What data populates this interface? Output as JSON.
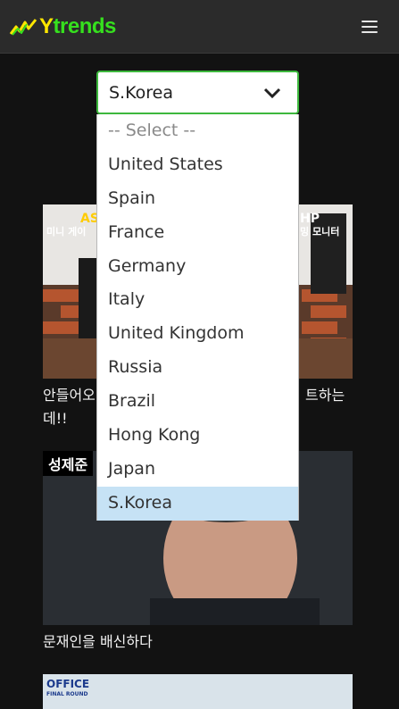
{
  "header": {
    "logo_y": "Y",
    "logo_rest": "trends",
    "menu_icon": "hamburger-icon",
    "colors": {
      "background": "#2b2b2b",
      "logo_y": "#ffe600",
      "logo_rest": "#36e01e"
    }
  },
  "country_select": {
    "selected": "S.Korea",
    "chevron_icon": "chevron-down-icon",
    "border_color": "#3db83d",
    "options": [
      "-- Select --",
      "United States",
      "Spain",
      "France",
      "Germany",
      "Italy",
      "United Kingdom",
      "Russia",
      "Brazil",
      "Hong Kong",
      "Japan",
      "S.Korea"
    ],
    "highlight_color": "#c6e2f5"
  },
  "videos": [
    {
      "title": "안들어오 트하는 데!!",
      "title_line1_left": "안들어오",
      "title_line1_right": "트하는",
      "title_line2": "데!!",
      "thumb_labels": {
        "left_top": "ASU",
        "left_bottom": "미니 게이",
        "right_top": "HP",
        "right_bottom": "밍 모니터"
      }
    },
    {
      "title": "문재인을 배신하다",
      "thumb_label": "성제준"
    },
    {
      "thumb_label": "OFFICE",
      "thumb_sub": "FINAL ROUND"
    }
  ]
}
